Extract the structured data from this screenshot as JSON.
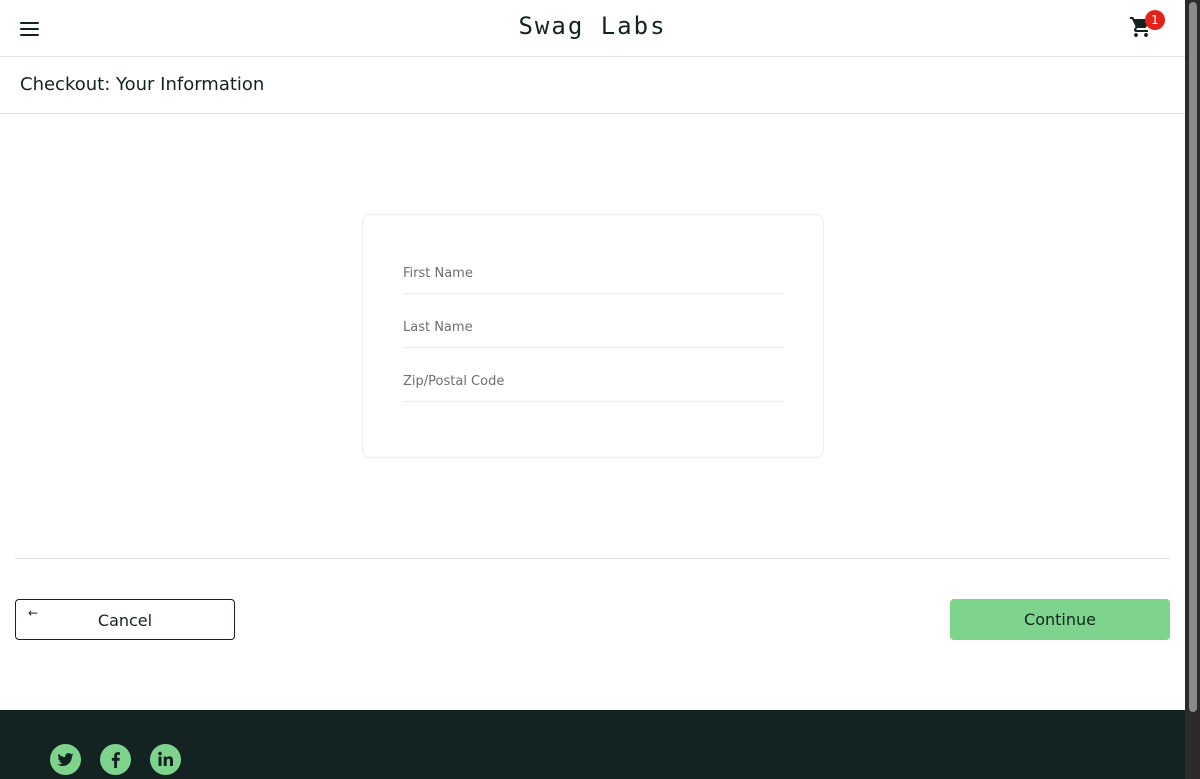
{
  "header": {
    "app_logo": "Swag Labs",
    "cart_badge_count": "1",
    "menu_icon": "hamburger-menu-icon",
    "cart_icon": "shopping-cart-icon"
  },
  "page": {
    "title": "Checkout: Your Information"
  },
  "form": {
    "first_name": {
      "placeholder": "First Name",
      "value": ""
    },
    "last_name": {
      "placeholder": "Last Name",
      "value": ""
    },
    "postal_code": {
      "placeholder": "Zip/Postal Code",
      "value": ""
    }
  },
  "actions": {
    "cancel_label": "Cancel",
    "cancel_icon": "arrow-left-icon",
    "continue_label": "Continue"
  },
  "footer": {
    "social": [
      "twitter-icon",
      "facebook-icon",
      "linkedin-icon"
    ]
  },
  "colors": {
    "accent": "#7ed48d",
    "footer_bg": "#132322",
    "badge": "#e2231a",
    "text": "#132322"
  }
}
